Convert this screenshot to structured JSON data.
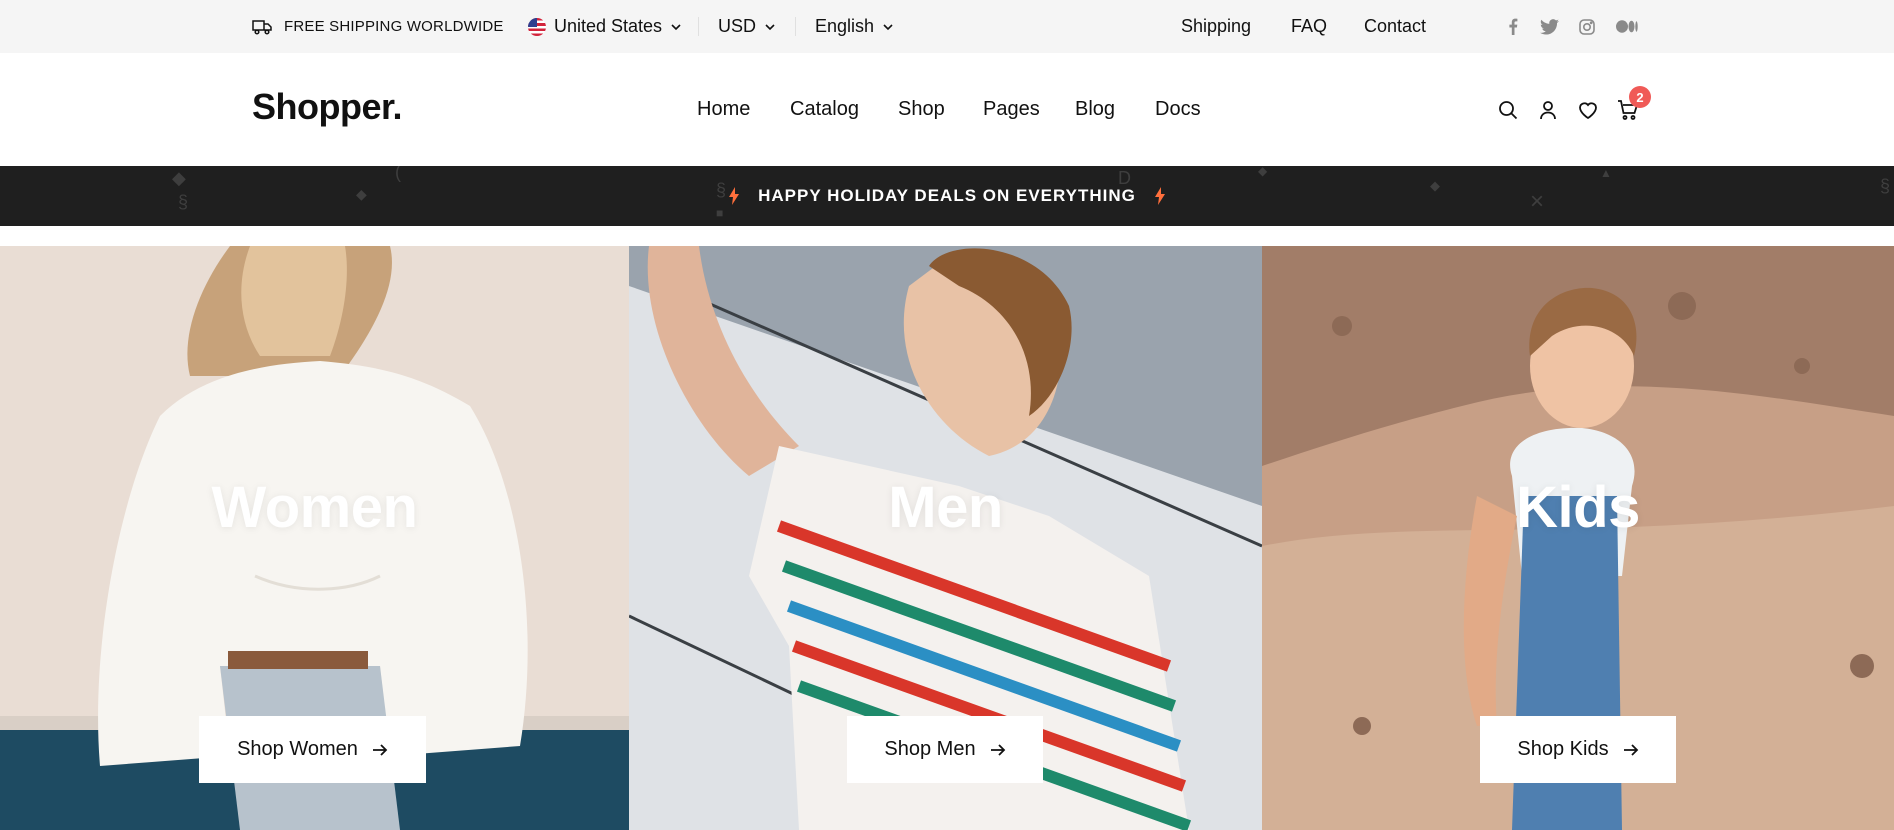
{
  "topbar": {
    "shipping_notice": "FREE SHIPPING WORLDWIDE",
    "shipping_icon": "truck-icon",
    "country": "United States",
    "country_icon": "us-flag-icon",
    "currency": "USD",
    "language": "English",
    "links": [
      "Shipping",
      "FAQ",
      "Contact"
    ],
    "social_icons": [
      "facebook-icon",
      "twitter-icon",
      "instagram-icon",
      "medium-icon"
    ]
  },
  "header": {
    "logo": "Shopper.",
    "nav": [
      "Home",
      "Catalog",
      "Shop",
      "Pages",
      "Blog",
      "Docs"
    ],
    "icons": [
      "search-icon",
      "user-icon",
      "heart-icon",
      "cart-icon"
    ],
    "cart_count": "2"
  },
  "promo": {
    "text": "HAPPY HOLIDAY DEALS ON EVERYTHING",
    "icon": "lightning-icon"
  },
  "categories": [
    {
      "title": "Women",
      "button": "Shop Women"
    },
    {
      "title": "Men",
      "button": "Shop Men"
    },
    {
      "title": "Kids",
      "button": "Shop Kids"
    }
  ],
  "colors": {
    "topbar_bg": "#f5f5f5",
    "promo_bg": "#1f1f1f",
    "badge": "#f05a57",
    "bolt": "#ff6f3c"
  }
}
